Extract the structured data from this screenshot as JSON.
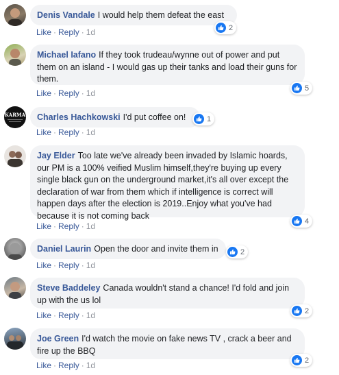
{
  "colors": {
    "link": "#385898",
    "bubble": "#f2f3f5",
    "like_blue": "#1877f2",
    "muted": "#90949c"
  },
  "labels": {
    "like": "Like",
    "reply": "Reply",
    "separator": "·"
  },
  "comments": [
    {
      "author": "Denis Vandale",
      "text": "I would help them defeat the east",
      "time": "1d",
      "reactions": "2",
      "avatar_icon": "user-avatar"
    },
    {
      "author": "Michael Iafano",
      "text": "If they took trudeau/wynne out of power and put them on an island - I would gas up their tanks and load their guns for them.",
      "time": "1d",
      "reactions": "5",
      "avatar_icon": "user-avatar"
    },
    {
      "author": "Charles Hachkowski",
      "text": "I'd put coffee on!",
      "time": "1d",
      "reactions": "1",
      "avatar_icon": "karma-logo-avatar",
      "avatar_text": "KARMA"
    },
    {
      "author": "Jay Elder",
      "text": "Too late we've already been invaded by Islamic hoards, our PM is a 100% veified Muslim himself,they're buying up every single black gun on the underground market,it's all over except the declaration of war from them which if intelligence is correct will happen days after the election is 2019..Enjoy what you've had because it is not coming back",
      "time": "1d",
      "reactions": "4",
      "avatar_icon": "user-avatar"
    },
    {
      "author": "Daniel Laurin",
      "text": "Open the door and invite them in",
      "time": "1d",
      "reactions": "2",
      "avatar_icon": "user-avatar"
    },
    {
      "author": "Steve Baddeley",
      "text": "Canada wouldn't stand a chance! I'd fold and join up with the us lol",
      "time": "1d",
      "reactions": "2",
      "avatar_icon": "user-avatar"
    },
    {
      "author": "Joe Green",
      "text": "I'd watch the movie on fake news TV , crack a beer and fire up the BBQ",
      "time": "1d",
      "reactions": "2",
      "avatar_icon": "user-avatar"
    }
  ]
}
